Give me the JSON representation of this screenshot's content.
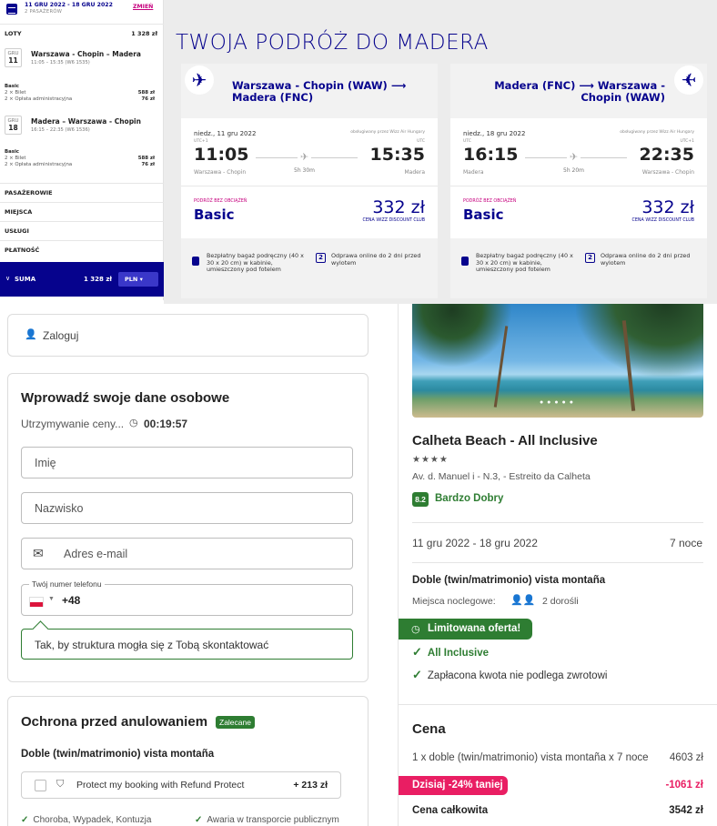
{
  "booking_sidebar": {
    "date_range": "11 GRU 2022 - 18 GRU 2022",
    "passengers": "2 PASAŻERÓW",
    "change_label": "ZMIEŃ",
    "flights_label": "LOTY",
    "flights_total": "1 328 zł",
    "flights": [
      {
        "month": "GRU",
        "day": "11",
        "route": "Warszawa - Chopin – Madera",
        "times": "11:05 – 15:35 (W6 1535)",
        "fare": "Basic",
        "ticket_line": "2 × Bilet",
        "ticket_price": "588 zł",
        "fee_line": "2 × Opłata administracyjna",
        "fee_price": "76 zł"
      },
      {
        "month": "GRU",
        "day": "18",
        "route": "Madera – Warszawa - Chopin",
        "times": "16:15 – 22:35 (W6 1536)",
        "fare": "Basic",
        "ticket_line": "2 × Bilet",
        "ticket_price": "588 zł",
        "fee_line": "2 × Opłata administracyjna",
        "fee_price": "76 zł"
      }
    ],
    "sections": [
      "PASAŻEROWIE",
      "MIEJSCA",
      "USŁUGI",
      "PŁATNOŚĆ"
    ],
    "sum_label": "SUMA",
    "sum_value": "1 328 zł",
    "currency": "PLN"
  },
  "trip": {
    "title": "TWOJA PODRÓŻ DO MADERA",
    "cards": [
      {
        "route": "Warszawa - Chopin (WAW) ⟶ Madera (FNC)",
        "date": "niedz., 11 gru 2022",
        "operated": "obsługiwany przez Wizz Air Hungary",
        "utc_dep": "UTC+1",
        "utc_arr": "UTC",
        "dep_time": "11:05",
        "arr_time": "15:35",
        "duration": "5h 30m",
        "from": "Warszawa - Chopin",
        "to": "Madera",
        "no_baggage": "PODRÓŻ BEZ OBCIĄŻEŃ",
        "fare": "Basic",
        "price": "332 zł",
        "club": "CENA WIZZ DISCOUNT CLUB",
        "bag_text": "Bezpłatny bagaż podręczny (40 x 30 x 20 cm) w kabinie, umieszczony pod fotelem",
        "checkin_text": "Odprawa online do 2 dni przed wylotem"
      },
      {
        "route": "Madera (FNC) ⟶ Warszawa - Chopin (WAW)",
        "date": "niedz., 18 gru 2022",
        "operated": "obsługiwany przez Wizz Air Hungary",
        "utc_dep": "UTC",
        "utc_arr": "UTC+1",
        "dep_time": "16:15",
        "arr_time": "22:35",
        "duration": "5h 20m",
        "from": "Madera",
        "to": "Warszawa - Chopin",
        "no_baggage": "PODRÓŻ BEZ OBCIĄŻEŃ",
        "fare": "Basic",
        "price": "332 zł",
        "club": "CENA WIZZ DISCOUNT CLUB",
        "bag_text": "Bezpłatny bagaż podręczny (40 x 30 x 20 cm) w kabinie, umieszczony pod fotelem",
        "checkin_text": "Odprawa online do 2 dni przed wylotem"
      }
    ]
  },
  "login": {
    "label": "Zaloguj"
  },
  "personal": {
    "title": "Wprowadź swoje dane osobowe",
    "hold_text": "Utrzymywanie ceny...",
    "timer": "00:19:57",
    "first_name_placeholder": "Imię",
    "last_name_placeholder": "Nazwisko",
    "email_placeholder": "Adres e-mail",
    "phone_label": "Twój numer telefonu",
    "phone_code": "+48",
    "contact_hint": "Tak, by struktura mogła się z Tobą skontaktować"
  },
  "cancellation": {
    "title": "Ochrona przed anulowaniem",
    "badge": "Zalecane",
    "room": "Doble (twin/matrimonio) vista montaña",
    "refund_text": "Protect my booking with Refund Protect",
    "refund_price": "+ 213 zł",
    "coverage": [
      "Choroba, Wypadek, Kontuzja",
      "Awaria w transporcie publicznym"
    ]
  },
  "hotel": {
    "name": "Calheta Beach - All Inclusive",
    "stars": "★★★★",
    "address": "Av. d. Manuel i - N.3, - Estreito da Calheta",
    "rating": "8.2",
    "rating_label": "Bardzo Dobry",
    "dates": "11 gru 2022 - 18 gru 2022",
    "nights": "7 noce",
    "room": "Doble (twin/matrimonio) vista montaña",
    "beds_label": "Miejsca noclegowe:",
    "beds_value": "2 dorośli",
    "limited_offer": "Limitowana oferta!",
    "inclusions": [
      "All Inclusive",
      "Zapłacona kwota nie podlega zwrotowi"
    ],
    "price_title": "Cena",
    "price_line": "1 x doble (twin/matrimonio) vista montaña x 7 noce",
    "price_line_value": "4603 zł",
    "discount_label": "Dzisiaj -24% taniej",
    "discount_value": "-1061 zł",
    "total_label": "Cena całkowita",
    "total_value": "3542 zł"
  },
  "colors": {
    "wizz_navy": "#06038d",
    "wizz_magenta": "#c6007e",
    "green": "#2e7d32",
    "pink": "#e91e63"
  }
}
